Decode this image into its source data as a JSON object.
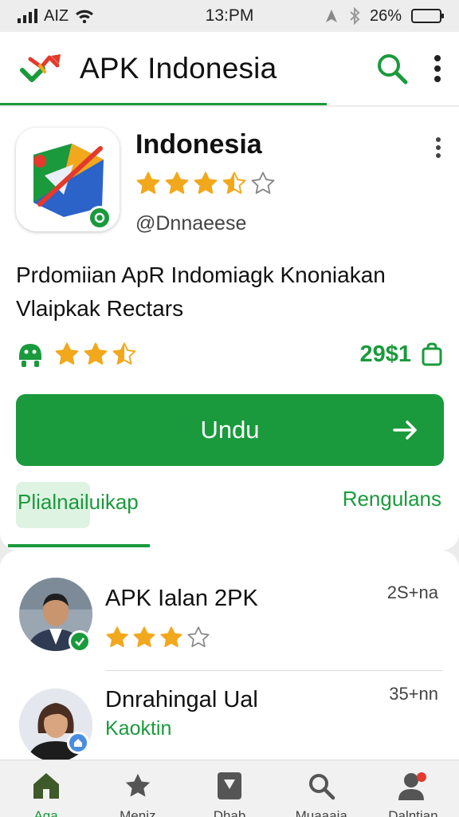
{
  "status_bar": {
    "carrier": "AIZ",
    "time": "13:PM",
    "battery": "26%",
    "battery_level": 0.26
  },
  "app_bar": {
    "title": "APK Indonesia",
    "icons": [
      "brand-logo",
      "search-icon",
      "more-vert-icon"
    ]
  },
  "app": {
    "name": "Indonesia",
    "rating": 3.5,
    "rating_max": 5,
    "handle": "@Dnnaeese",
    "description": "Prdomiian ApR Indomiagk Knoniakan Vlaipkak Rectars",
    "secondary_rating": 2.5,
    "price": "29$1",
    "download_label": "Undu",
    "tab_left": "Plialnailuikap",
    "tab_right": "Rengulans"
  },
  "list": [
    {
      "title": "APK Ialan 2PK",
      "meta": "2S+na",
      "rating": 3,
      "rating_max": 5,
      "badge": "verified"
    },
    {
      "title": "Dnrahingal Ual",
      "subtitle": "Kaoktin",
      "meta": "35+nn",
      "badge": "home"
    }
  ],
  "bottom_nav": [
    {
      "label": "Aga",
      "icon": "home-icon",
      "active": true
    },
    {
      "label": "Meniz",
      "icon": "star-icon",
      "active": false
    },
    {
      "label": "Dhab",
      "icon": "bookmark-icon",
      "active": false
    },
    {
      "label": "Muaaaia",
      "icon": "search-icon",
      "active": false
    },
    {
      "label": "Dalntian",
      "icon": "profile-icon",
      "active": false
    }
  ],
  "colors": {
    "accent": "#1a9a3c",
    "star": "#f2a81d",
    "background": "#ececec"
  }
}
